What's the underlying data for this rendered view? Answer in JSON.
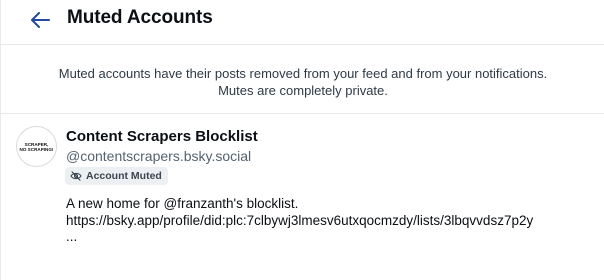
{
  "header": {
    "title": "Muted Accounts",
    "back_icon": "arrow-left-icon"
  },
  "notice": {
    "line1": "Muted accounts have their posts removed from your feed and from your notifications.",
    "line2": "Mutes are completely private."
  },
  "account": {
    "avatar_text_line1": "SCRAPER,",
    "avatar_text_line2": "NO SCRAPING!",
    "display_name": "Content Scrapers Blocklist",
    "handle": "@contentscrapers.bsky.social",
    "badge_label": "Account Muted",
    "badge_icon": "eye-slash-icon",
    "bio": "A new home for @franzanth's blocklist.\nhttps://bsky.app/profile/did:plc:7clbywj3lmesv6utxqocmzdy/lists/3lbqvvdsz7p2y\n..."
  },
  "colors": {
    "accent": "#1f4aa0",
    "muted_text": "#55636f",
    "badge_bg": "#edf0f3",
    "divider": "#e6e9ee"
  }
}
